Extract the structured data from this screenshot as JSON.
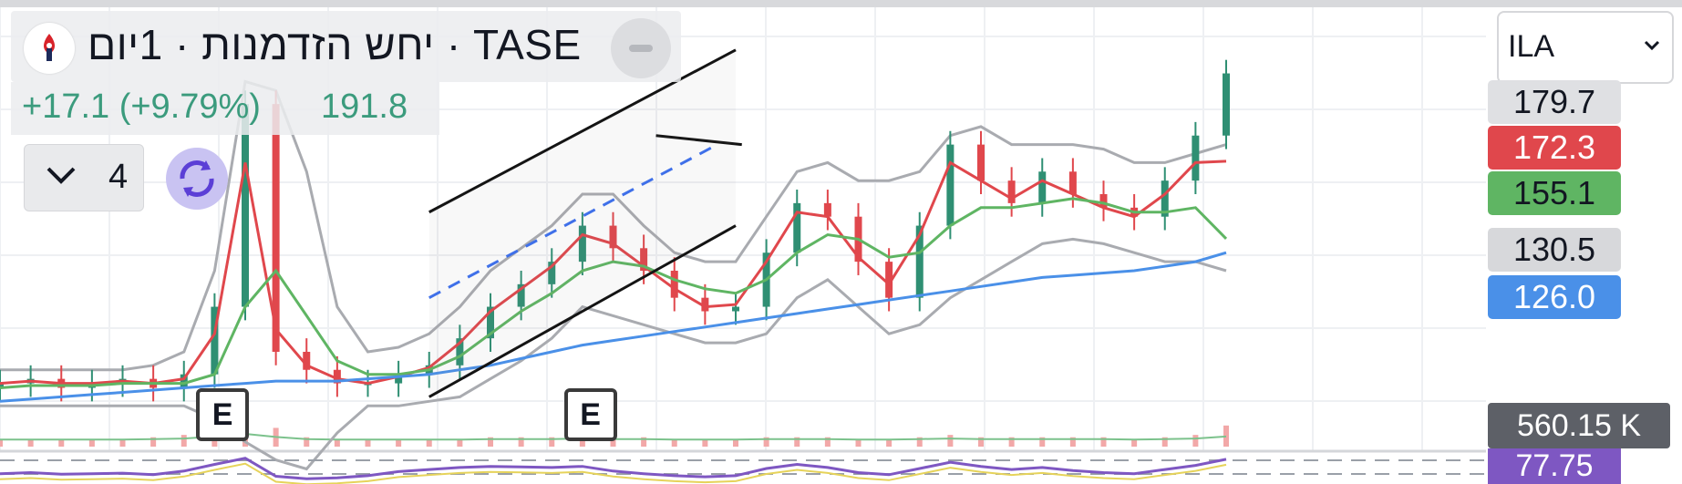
{
  "header": {
    "title": "יחש הזדמנות · 1יום · TASE",
    "change": "+17.1 (+9.79%)",
    "last_price": "191.8",
    "collapsed_count": "4"
  },
  "symbol_select": {
    "value": "ILA"
  },
  "price_labels": [
    {
      "value": "179.7",
      "color": "#dfe0e3",
      "text_color": "#131722"
    },
    {
      "value": "172.3",
      "color": "#e0474c",
      "text_color": "#ffffff"
    },
    {
      "value": "155.1",
      "color": "#5fb563",
      "text_color": "#131722"
    },
    {
      "value": "130.5",
      "color": "#d7d8db",
      "text_color": "#131722"
    },
    {
      "value": "126.0",
      "color": "#4a90e8",
      "text_color": "#ffffff"
    }
  ],
  "events": [
    {
      "label": "E"
    },
    {
      "label": "E"
    }
  ],
  "volume_label": "560.15 K",
  "rsi_label": "77.75",
  "chart_data": {
    "type": "candlestick",
    "title": "",
    "x": [
      0,
      5,
      10,
      15,
      20,
      25,
      30,
      35,
      40,
      45,
      50,
      55,
      60,
      65,
      70,
      75,
      80,
      85,
      90,
      95,
      100,
      105,
      110,
      115,
      120,
      125,
      130,
      135,
      140,
      145,
      150,
      155,
      160,
      165,
      170,
      175,
      180,
      185,
      190,
      195,
      200
    ],
    "series": [
      {
        "kind": "close",
        "color": "#3b9b7d",
        "values": [
          123,
          124,
          122,
          123,
          124,
          122,
          125,
          140,
          185,
          130,
          126,
          123,
          123,
          125,
          127,
          133,
          140,
          145,
          150,
          158,
          153,
          148,
          142,
          139,
          140,
          152,
          163,
          160,
          150,
          142,
          158,
          176,
          168,
          163,
          170,
          165,
          162,
          160,
          168,
          178,
          191.8
        ]
      },
      {
        "kind": "ma",
        "color": "#e0474c",
        "values": [
          123,
          123.5,
          123,
          123,
          123.5,
          123,
          124,
          134,
          172,
          135,
          127,
          124,
          123,
          124.5,
          126.5,
          132,
          139,
          144,
          149,
          156,
          154,
          149,
          144,
          140,
          140.5,
          150,
          161,
          160,
          151,
          145,
          156,
          172,
          168,
          164,
          168,
          165,
          162,
          160,
          165,
          172,
          172.3
        ]
      },
      {
        "kind": "ma",
        "color": "#5fb563",
        "values": [
          122,
          122.5,
          122.5,
          122.5,
          123,
          123,
          123,
          125,
          140,
          148,
          138,
          128,
          125,
          125,
          126,
          129,
          134,
          139,
          143,
          148,
          150,
          149,
          146,
          144,
          143,
          146,
          152,
          156,
          155,
          151,
          152,
          158,
          162,
          162,
          163,
          164,
          163,
          161,
          161,
          162,
          155.1
        ]
      },
      {
        "kind": "ma",
        "color": "#4a90e8",
        "values": [
          119,
          119.5,
          120,
          120.5,
          121,
          121.5,
          122,
          122.5,
          123,
          123.5,
          123.5,
          123.5,
          124,
          124.5,
          125,
          126,
          127,
          128.5,
          130,
          131.5,
          132.5,
          133.5,
          134.5,
          135.5,
          136.5,
          137.5,
          138.5,
          139.5,
          140.5,
          141.5,
          142.5,
          143.5,
          144.5,
          145.5,
          146.5,
          147,
          147.5,
          148,
          149,
          150,
          152
        ]
      },
      {
        "kind": "band_upper",
        "color": "#a9abb0",
        "values": [
          126,
          126,
          126,
          126,
          126,
          127,
          130,
          148,
          190,
          188,
          170,
          140,
          130,
          131,
          134,
          140,
          148,
          153,
          158,
          165,
          165,
          158,
          152,
          150,
          150,
          160,
          170,
          172,
          168,
          168,
          170,
          178,
          180,
          176,
          176,
          176,
          175,
          172,
          172,
          174,
          176
        ]
      },
      {
        "kind": "band_lower",
        "color": "#a9abb0",
        "values": [
          118,
          118,
          118,
          118,
          118,
          118,
          118,
          115,
          110,
          106,
          104,
          112,
          118,
          118,
          119,
          120,
          124,
          128,
          133,
          140,
          138,
          136,
          134,
          132,
          132,
          134,
          142,
          146,
          140,
          134,
          136,
          142,
          146,
          150,
          154,
          155,
          154,
          152,
          150,
          150,
          148
        ]
      }
    ],
    "volume": [
      3,
      3,
      3,
      3,
      3,
      4,
      5,
      9,
      14,
      8,
      4,
      3,
      3,
      3,
      3,
      3,
      4,
      4,
      4,
      5,
      4,
      4,
      3,
      3,
      3,
      4,
      4,
      4,
      3,
      3,
      4,
      5,
      4,
      4,
      4,
      4,
      4,
      3,
      4,
      5,
      9
    ],
    "rsi": [
      50,
      52,
      49,
      50,
      51,
      48,
      55,
      68,
      80,
      45,
      40,
      42,
      46,
      54,
      58,
      62,
      64,
      63,
      62,
      64,
      55,
      50,
      46,
      44,
      46,
      60,
      68,
      62,
      52,
      48,
      60,
      72,
      64,
      58,
      62,
      56,
      52,
      50,
      58,
      66,
      77.75
    ],
    "channel": {
      "upper": [
        [
          70,
          161
        ],
        [
          120,
          197
        ]
      ],
      "lower": [
        [
          70,
          120
        ],
        [
          120,
          158
        ]
      ],
      "mid": [
        [
          70,
          142
        ],
        [
          117,
          176
        ]
      ],
      "resistance": [
        [
          107,
          178
        ],
        [
          121,
          176
        ]
      ]
    },
    "events_x": [
      36,
      96
    ],
    "ylim": [
      113,
      200
    ],
    "grid": true
  }
}
